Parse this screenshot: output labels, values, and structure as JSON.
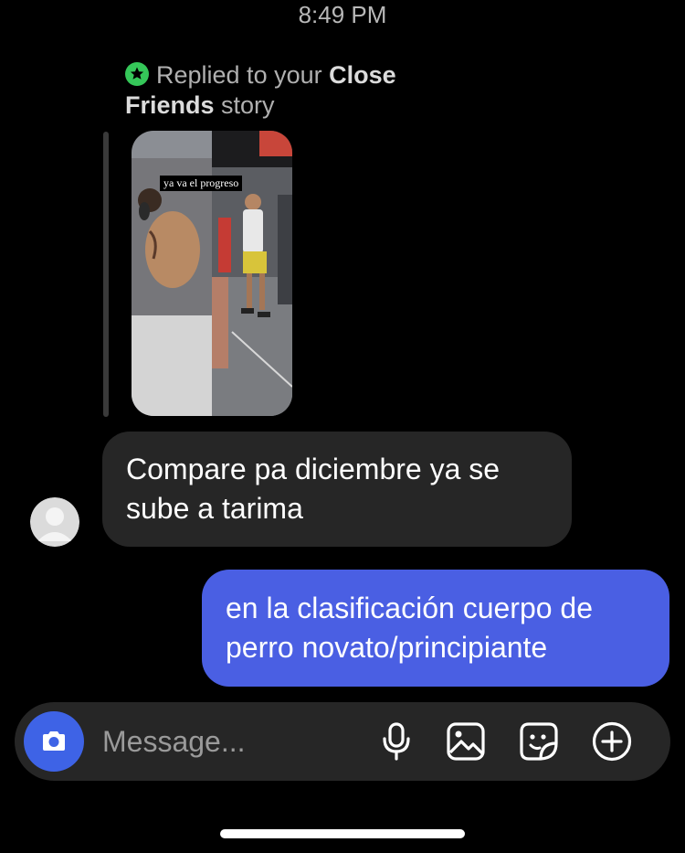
{
  "status": {
    "time": "8:49 PM"
  },
  "reply_context": {
    "prefix": "Replied to your ",
    "emphasis_1": "Close",
    "emphasis_2": "Friends",
    "suffix": " story",
    "badge_color": "#35c759",
    "story_caption": "ya va el progreso"
  },
  "messages": [
    {
      "direction": "incoming",
      "text": "Compare pa diciembre ya se sube a tarima",
      "bubble_color": "#262626"
    },
    {
      "direction": "outgoing",
      "text": "en la clasificación cuerpo de perro novato/principiante",
      "bubble_color": "#4a5fe3"
    }
  ],
  "composer": {
    "placeholder": "Message...",
    "value": "",
    "camera_color": "#3e63e6",
    "icons": [
      "camera-icon",
      "microphone-icon",
      "image-icon",
      "sticker-icon",
      "add-circle-icon"
    ]
  }
}
